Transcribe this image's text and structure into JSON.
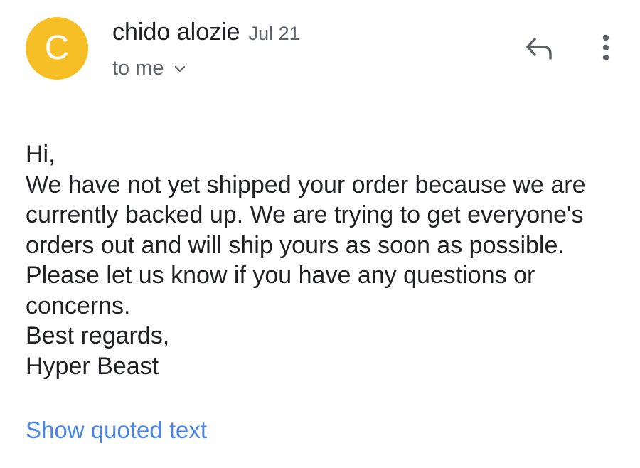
{
  "sender": {
    "avatar_letter": "C",
    "avatar_color": "#F6BF26",
    "name": "chido alozie",
    "date": "Jul 21"
  },
  "recipient": {
    "label": "to me",
    "chevron_icon": "chevron-down-icon"
  },
  "actions": {
    "reply_icon": "reply-icon",
    "more_icon": "more-vert-icon"
  },
  "message": {
    "greeting": "Hi,",
    "paragraph_1": "We have not yet shipped your order because we are currently backed up.  We are trying to get everyone's orders out and will ship yours as soon as possible.",
    "paragraph_2": "Please let us know if you have any questions or concerns.",
    "closing": "Best regards,",
    "signature": "Hyper Beast"
  },
  "show_quoted_text": "Show quoted text",
  "colors": {
    "link": "#4A86E8",
    "secondary_text": "#5f6368",
    "primary_text": "#202124"
  }
}
